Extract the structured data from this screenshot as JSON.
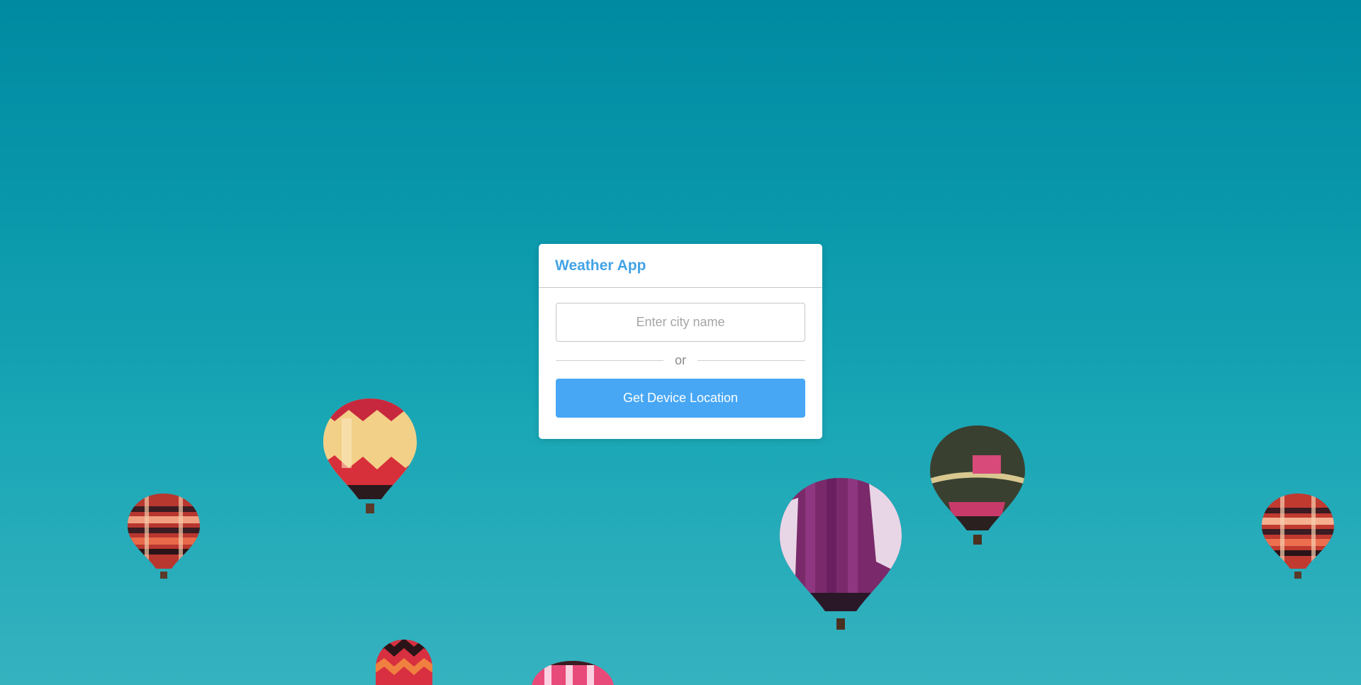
{
  "app": {
    "title": "Weather App"
  },
  "search": {
    "placeholder": "Enter city name",
    "value": ""
  },
  "divider": {
    "text": "or"
  },
  "location": {
    "button_label": "Get Device Location"
  },
  "colors": {
    "accent": "#43a3e6",
    "button": "#47a7f5",
    "sky_top": "#008aa1",
    "sky_bottom": "#36b2bf"
  },
  "background": {
    "scene": "hot-air-balloons-sky"
  }
}
